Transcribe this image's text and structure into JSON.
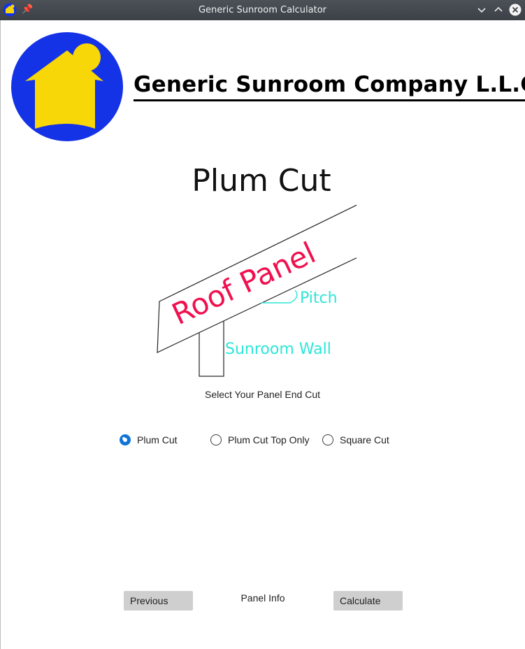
{
  "window": {
    "title": "Generic Sunroom Calculator",
    "app_icon": "house-icon",
    "pin_icon": "pin-icon",
    "controls": [
      "minimize-icon",
      "maximize-icon",
      "close-icon"
    ]
  },
  "header": {
    "company_name": "Generic Sunroom Company L.L.C.",
    "logo": "house-logo"
  },
  "illustration": {
    "heading": "Plum Cut",
    "panel_label": "Roof Panel",
    "pitch_label": "Pitch",
    "wall_label": "Sunroom Wall",
    "colors": {
      "panel_text": "#f0104f",
      "annotation": "#2de6d8",
      "outline": "#222222"
    }
  },
  "form": {
    "prompt": "Select Your Panel End Cut",
    "options": [
      {
        "label": "Plum Cut",
        "checked": true
      },
      {
        "label": "Plum Cut Top Only",
        "checked": false
      },
      {
        "label": "Square Cut",
        "checked": false
      }
    ]
  },
  "footer": {
    "previous_label": "Previous",
    "page_label": "Panel Info",
    "calculate_label": "Calculate"
  },
  "colors": {
    "logo_blue": "#1432e6",
    "logo_yellow": "#f7d708",
    "radio_accent": "#0f74d6",
    "button_bg": "#cfcfcf"
  }
}
